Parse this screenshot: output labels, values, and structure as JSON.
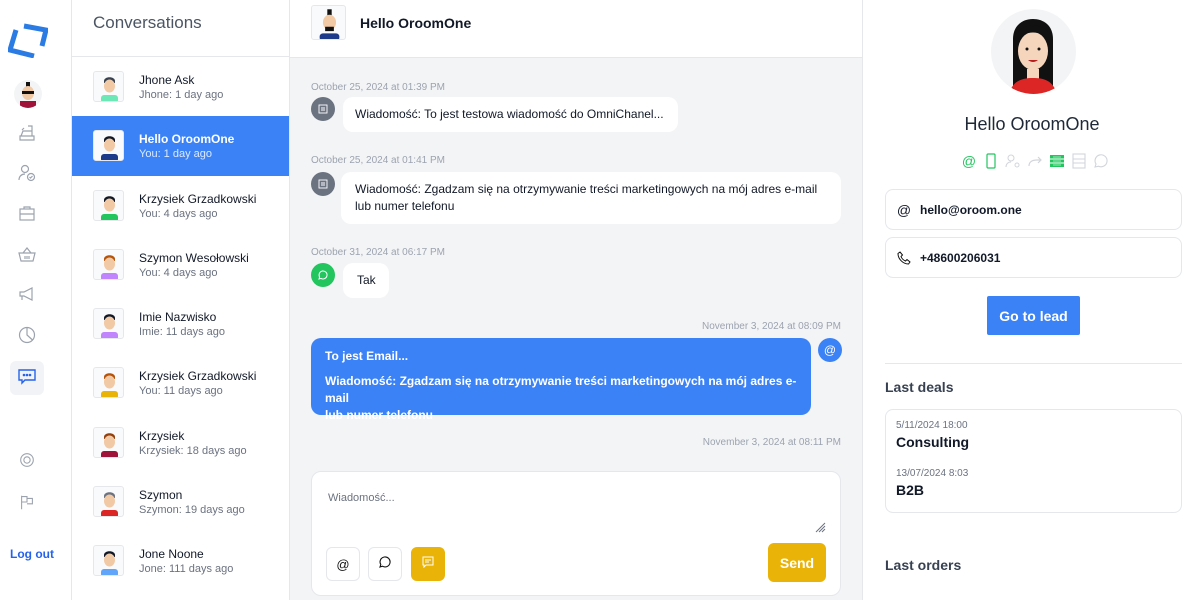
{
  "nav": {
    "items": [
      {
        "name": "cash-register-icon",
        "label": "Sales"
      },
      {
        "name": "user-check-icon",
        "label": "Contacts"
      },
      {
        "name": "briefcase-icon",
        "label": "Deals"
      },
      {
        "name": "basket-icon",
        "label": "Orders"
      },
      {
        "name": "megaphone-icon",
        "label": "Marketing"
      },
      {
        "name": "pie-chart-icon",
        "label": "Reports"
      },
      {
        "name": "chat-icon",
        "label": "Conversations",
        "active": true
      },
      {
        "name": "lifebuoy-icon",
        "label": "Support"
      },
      {
        "name": "flag-icon",
        "label": "Reports flag"
      }
    ],
    "logout_label": "Log out",
    "accent": "#2563eb"
  },
  "conversations": {
    "title": "Conversations",
    "items": [
      {
        "name": "Jhone Ask",
        "sub": "Jhone: 1 day ago",
        "shirt": "#6ee7b7",
        "hair": "#374151"
      },
      {
        "name": "Hello OroomOne",
        "sub": "You: 1 day ago",
        "shirt": "#1e3a8a",
        "hair": "#111827",
        "active": true
      },
      {
        "name": "Krzysiek Grzadkowski",
        "sub": "You: 4 days ago",
        "shirt": "#22c55e",
        "hair": "#111827"
      },
      {
        "name": "Szymon Wesołowski",
        "sub": "You: 4 days ago",
        "shirt": "#c084fc",
        "hair": "#b45309"
      },
      {
        "name": "Imie Nazwisko",
        "sub": "Imie: 11 days ago",
        "shirt": "#c084fc",
        "hair": "#111827"
      },
      {
        "name": "Krzysiek Grzadkowski",
        "sub": "You: 11 days ago",
        "shirt": "#eab308",
        "hair": "#b45309"
      },
      {
        "name": "Krzysiek",
        "sub": "Krzysiek: 18 days ago",
        "shirt": "#9f1239",
        "hair": "#92400e"
      },
      {
        "name": "Szymon",
        "sub": "Szymon: 19 days ago",
        "shirt": "#dc2626",
        "hair": "#6b7280"
      },
      {
        "name": "Jone Noone",
        "sub": "Jone: 111 days ago",
        "shirt": "#60a5fa",
        "hair": "#111827"
      }
    ]
  },
  "chat": {
    "header_name": "Hello OroomOne",
    "messages": [
      {
        "timestamp": "October 25, 2024 at 01:39 PM",
        "channel": "sms",
        "direction": "in",
        "lines": [
          "Wiadomość: To jest testowa wiadomość do OmniChanel..."
        ]
      },
      {
        "timestamp": "October 25, 2024 at 01:41 PM",
        "channel": "sms",
        "direction": "in",
        "lines": [
          "Wiadomość: Zgadzam się na otrzymywanie treści marketingowych na mój adres e-mail",
          "lub numer telefonu"
        ]
      },
      {
        "timestamp": "October 31, 2024 at 06:17 PM",
        "channel": "whatsapp",
        "direction": "in",
        "lines": [
          "Tak"
        ]
      },
      {
        "timestamp": "November 3, 2024 at 08:09 PM",
        "channel": "email",
        "direction": "out",
        "subject": "To jest Email...",
        "lines": [
          "Wiadomość: Zgadzam się na otrzymywanie treści marketingowych na mój adres e-mail",
          "lub numer telefonu"
        ]
      },
      {
        "timestamp": "November 3, 2024 at 08:11 PM",
        "direction": "out"
      }
    ],
    "composer": {
      "placeholder": "Wiadomość...",
      "value": "",
      "channels": [
        "email",
        "whatsapp",
        "sms"
      ],
      "active_channel": "sms",
      "send_label": "Send"
    },
    "colors": {
      "outgoing": "#3b82f6",
      "sms_icon": "#6b7280",
      "whatsapp_icon": "#22c55e",
      "send": "#eab308"
    }
  },
  "profile": {
    "name": "Hello OroomOne",
    "channel_icons": [
      {
        "name": "at-icon",
        "enabled": true
      },
      {
        "name": "phone-icon",
        "enabled": true
      },
      {
        "name": "user-settings-icon",
        "enabled": false
      },
      {
        "name": "forward-icon",
        "enabled": false
      },
      {
        "name": "list-icon",
        "enabled": true
      },
      {
        "name": "list-outline-icon",
        "enabled": false
      },
      {
        "name": "whatsapp-icon",
        "enabled": false
      }
    ],
    "email": "hello@oroom.one",
    "phone": "+48600206031",
    "go_to_lead_label": "Go to lead",
    "last_deals_title": "Last deals",
    "deals": [
      {
        "date": "5/11/2024 18:00",
        "name": "Consulting"
      },
      {
        "date": "13/07/2024 8:03",
        "name": "B2B"
      }
    ],
    "last_orders_title": "Last orders",
    "accent_green": "#22c55e"
  }
}
